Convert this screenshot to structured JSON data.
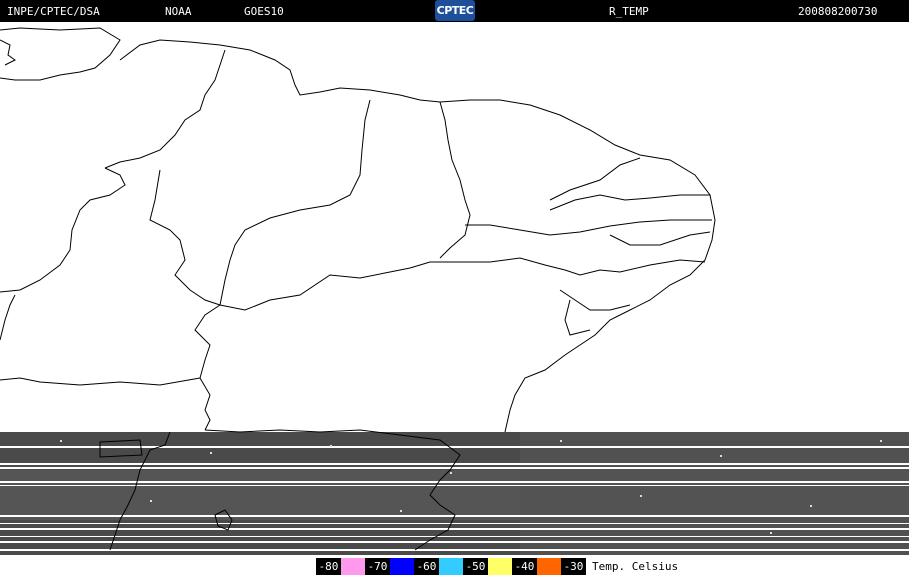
{
  "header": {
    "institution": "INPE/CPTEC/DSA",
    "agency": "NOAA",
    "satellite": "GOES10",
    "logo_text": "CPTEC",
    "product": "R_TEMP",
    "datetime": "200808200730"
  },
  "legend": {
    "title": "Temp. Celsius",
    "items": [
      {
        "label": "-80",
        "color": "#ff99ee"
      },
      {
        "label": "-70",
        "color": "#0000ff"
      },
      {
        "label": "-60",
        "color": "#33ccff"
      },
      {
        "label": "-50",
        "color": "#ffff66"
      },
      {
        "label": "-40",
        "color": "#ff6600"
      },
      {
        "label": "-30",
        "color": null
      }
    ]
  },
  "map": {
    "region": "Northeast Brazil",
    "imagery_band_color": "#4a4a4a",
    "border_color": "#000000"
  }
}
